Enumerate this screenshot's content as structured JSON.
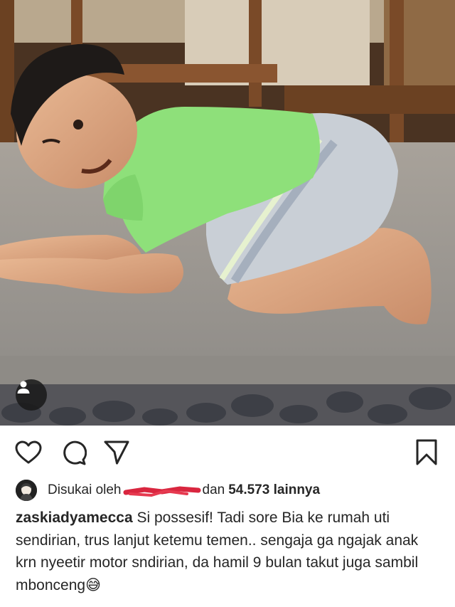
{
  "post": {
    "image_alt": "photo",
    "user_tag_icon": "user-icon",
    "colors": {
      "shirt": "#8ee07a",
      "shorts": "#c9cfd6",
      "floor": "#9c9a96",
      "text": "#262626"
    }
  },
  "actions": {
    "like_icon": "heart-icon",
    "comment_icon": "comment-icon",
    "share_icon": "send-icon",
    "save_icon": "bookmark-icon"
  },
  "likes": {
    "prefix": "Disukai oleh",
    "connector": "dan",
    "count": "54.573 lainnya"
  },
  "caption": {
    "username": "zaskiadyamecca",
    "text": "Si possesif! Tadi sore Bia ke rumah uti sendirian, trus lanjut ketemu temen.. sengaja ga ngajak anak krn nyeetir motor sndirian, da hamil 9 bulan takut juga sambil mbonceng",
    "emoji": "😅"
  }
}
